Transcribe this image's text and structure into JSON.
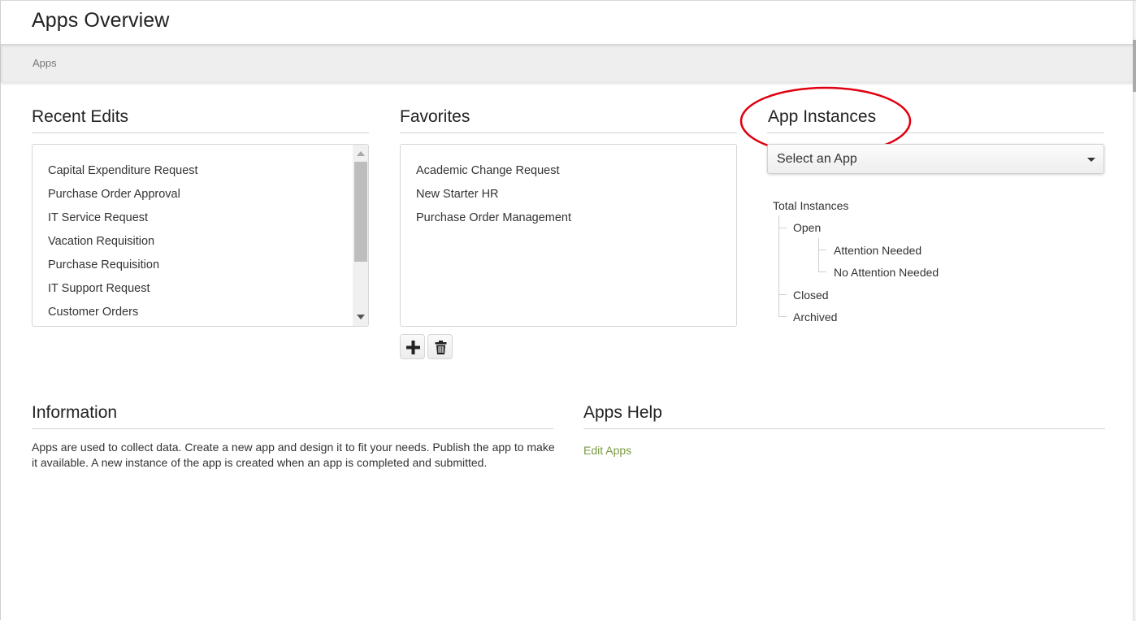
{
  "header": {
    "title": "Apps Overview"
  },
  "breadcrumb": {
    "items": [
      "Apps"
    ]
  },
  "recent_edits": {
    "title": "Recent Edits",
    "items": [
      "Capital Expenditure Request",
      "Purchase Order Approval",
      "IT Service Request",
      "Vacation Requisition",
      "Purchase Requisition",
      "IT Support Request",
      "Customer Orders"
    ]
  },
  "favorites": {
    "title": "Favorites",
    "items": [
      "Academic Change Request",
      "New Starter HR",
      "Purchase Order Management"
    ],
    "add_icon": "plus-icon",
    "delete_icon": "trash-icon"
  },
  "app_instances": {
    "title": "App Instances",
    "select": {
      "selected": "Select an App"
    },
    "tree": {
      "root": "Total Instances",
      "open": "Open",
      "attention_needed": "Attention Needed",
      "no_attention_needed": "No Attention Needed",
      "closed": "Closed",
      "archived": "Archived"
    },
    "annotation_color": "#e0000f"
  },
  "information": {
    "title": "Information",
    "text": "Apps are used to collect data. Create a new app and design it to fit your needs. Publish the app to make it available. A new instance of the app is created when an app is completed and submitted."
  },
  "apps_help": {
    "title": "Apps Help",
    "links": [
      "Edit Apps"
    ],
    "link_color": "#7a9a43"
  }
}
